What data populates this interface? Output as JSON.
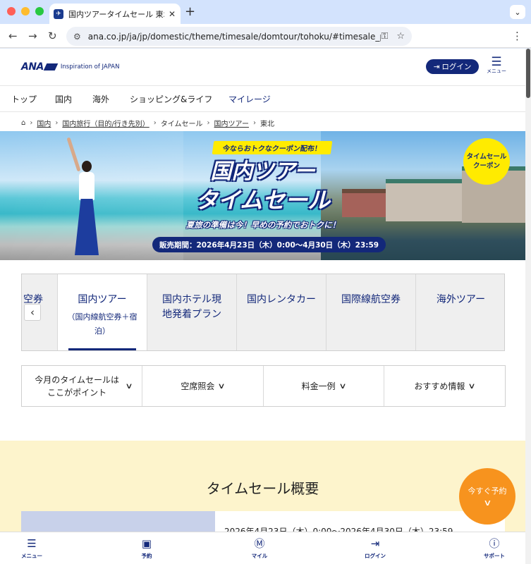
{
  "browser": {
    "tab_title": "国内ツアータイムセール 東北|ANA",
    "tab_close": "✕",
    "new_tab": "+",
    "tab_menu": "⌄",
    "url": "ana.co.jp/ja/jp/domestic/theme/timesale/domtour/tohoku/#timesale_price",
    "icons": [
      "back-arrow-icon",
      "forward-arrow-icon",
      "reload-icon",
      "site-settings-icon",
      "key-icon",
      "star-icon",
      "kebab-menu-icon"
    ],
    "colors": {
      "tab_strip": "#d3e3fd",
      "close": "#ff5f57",
      "minimize": "#febc2e",
      "maximize": "#28c840"
    }
  },
  "header": {
    "logo_text": "ANA",
    "logo_tagline": "Inspiration of JAPAN",
    "login_label": "ログイン",
    "menu_label": "メニュー",
    "brand_color": "#13287a"
  },
  "global_nav": [
    {
      "label": "トップ"
    },
    {
      "label": "国内"
    },
    {
      "label": "海外"
    },
    {
      "label": "ショッピング&ライフ"
    },
    {
      "label": "マイレージ"
    }
  ],
  "breadcrumb": {
    "home_icon": "home-icon",
    "items": [
      "国内",
      "国内旅行（目的/行き先別）",
      "タイムセール",
      "国内ツアー",
      "東北"
    ]
  },
  "banner": {
    "coupon_pill": "今ならおトクなクーポン配布！",
    "title_line1": "国内ツアー",
    "title_line2": "タイムセール",
    "subtitle": "夏旅の準備は今！早めの予約でおトクに！",
    "period": "販売期間：2026年4月23日（木）0:00～4月30日（木）23:59",
    "coupon_circle_line1": "タイムセール",
    "coupon_circle_line2": "クーポン"
  },
  "product_tabs": [
    {
      "label": "空券",
      "sub": ""
    },
    {
      "label": "国内ツアー",
      "sub": "（国内線航空券＋宿泊）"
    },
    {
      "label": "国内ホテル現地発着プラン",
      "sub": ""
    },
    {
      "label": "国内レンタカー",
      "sub": ""
    },
    {
      "label": "国際線航空券",
      "sub": ""
    },
    {
      "label": "海外ツアー",
      "sub": ""
    }
  ],
  "prev_arrow": "‹",
  "anchor_menu": [
    {
      "label": "今月のタイムセールはここがポイント"
    },
    {
      "label": "空席照会"
    },
    {
      "label": "料金一例"
    },
    {
      "label": "おすすめ情報"
    }
  ],
  "overview": {
    "title": "タイムセール概要",
    "period_text": "2026年4月23日（木）0:00～2026年4月30日（木）23:59",
    "bg_color": "#fdf4cc"
  },
  "reserve_fab": {
    "label": "今すぐ予約",
    "color": "#f7931e"
  },
  "bottom_nav": [
    {
      "label": "メニュー",
      "icon": "hamburger-icon"
    },
    {
      "label": "予約",
      "icon": "calendar-icon"
    },
    {
      "label": "マイル",
      "icon": "mile-icon"
    },
    {
      "label": "ログイン",
      "icon": "login-icon"
    },
    {
      "label": "サポート",
      "icon": "help-icon"
    }
  ]
}
